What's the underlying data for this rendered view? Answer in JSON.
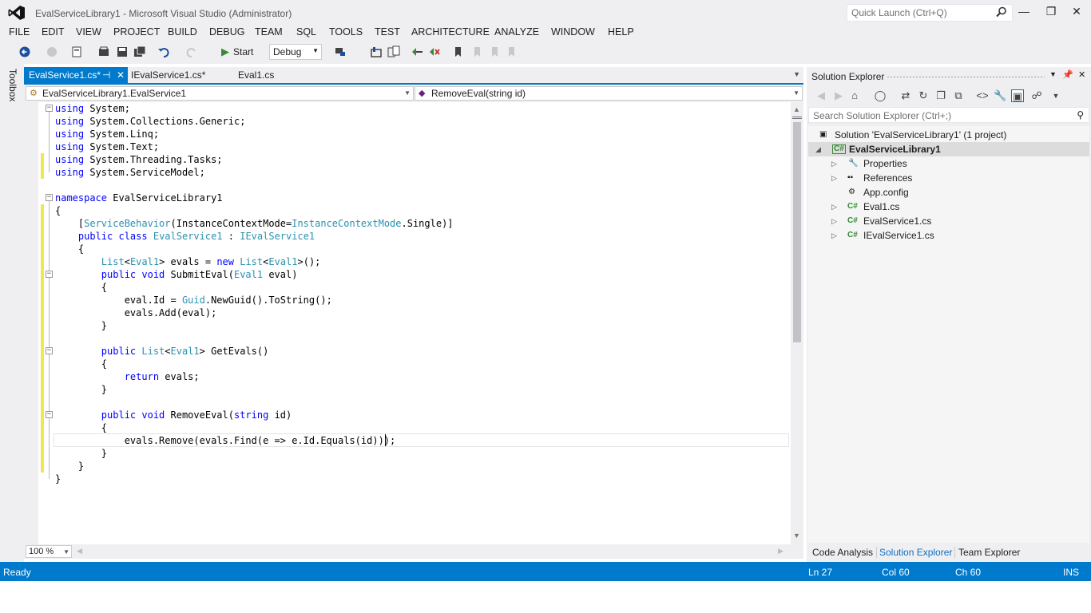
{
  "window": {
    "title": "EvalServiceLibrary1 - Microsoft Visual Studio (Administrator)",
    "quick_launch_placeholder": "Quick Launch (Ctrl+Q)"
  },
  "menu": [
    "FILE",
    "EDIT",
    "VIEW",
    "PROJECT",
    "BUILD",
    "DEBUG",
    "TEAM",
    "SQL",
    "TOOLS",
    "TEST",
    "ARCHITECTURE",
    "ANALYZE",
    "WINDOW",
    "HELP"
  ],
  "toolbar": {
    "start_label": "Start",
    "configuration": "Debug"
  },
  "toolbox_label": "Toolbox",
  "tabs": [
    {
      "label": "EvalService1.cs*",
      "active": true,
      "pin": "⊣",
      "close": "✕"
    },
    {
      "label": "IEvalService1.cs*",
      "active": false
    },
    {
      "label": "Eval1.cs",
      "active": false
    }
  ],
  "navigation": {
    "type_combo": "EvalServiceLibrary1.EvalService1",
    "member_combo": "RemoveEval(string id)"
  },
  "code_lines": [
    [
      {
        "t": "using",
        "c": "kw"
      },
      {
        "t": " System;"
      }
    ],
    [
      {
        "t": "using",
        "c": "kw"
      },
      {
        "t": " System.Collections.Generic;"
      }
    ],
    [
      {
        "t": "using",
        "c": "kw"
      },
      {
        "t": " System.Linq;"
      }
    ],
    [
      {
        "t": "using",
        "c": "kw"
      },
      {
        "t": " System.Text;"
      }
    ],
    [
      {
        "t": "using",
        "c": "kw"
      },
      {
        "t": " System.Threading.Tasks;"
      }
    ],
    [
      {
        "t": "using",
        "c": "kw"
      },
      {
        "t": " System.ServiceModel;"
      }
    ],
    [
      {
        "t": ""
      }
    ],
    [
      {
        "t": "namespace",
        "c": "kw"
      },
      {
        "t": " EvalServiceLibrary1"
      }
    ],
    [
      {
        "t": "{"
      }
    ],
    [
      {
        "t": "    ["
      },
      {
        "t": "ServiceBehavior",
        "c": "ty"
      },
      {
        "t": "(InstanceContextMode="
      },
      {
        "t": "InstanceContextMode",
        "c": "ty"
      },
      {
        "t": ".Single)]"
      }
    ],
    [
      {
        "t": "    "
      },
      {
        "t": "public class",
        "c": "kw"
      },
      {
        "t": " "
      },
      {
        "t": "EvalService1",
        "c": "ty"
      },
      {
        "t": " : "
      },
      {
        "t": "IEvalService1",
        "c": "ty"
      }
    ],
    [
      {
        "t": "    {"
      }
    ],
    [
      {
        "t": "        "
      },
      {
        "t": "List",
        "c": "ty"
      },
      {
        "t": "<"
      },
      {
        "t": "Eval1",
        "c": "ty"
      },
      {
        "t": "> evals = "
      },
      {
        "t": "new",
        "c": "kw"
      },
      {
        "t": " "
      },
      {
        "t": "List",
        "c": "ty"
      },
      {
        "t": "<"
      },
      {
        "t": "Eval1",
        "c": "ty"
      },
      {
        "t": ">();"
      }
    ],
    [
      {
        "t": "        "
      },
      {
        "t": "public void",
        "c": "kw"
      },
      {
        "t": " SubmitEval("
      },
      {
        "t": "Eval1",
        "c": "ty"
      },
      {
        "t": " eval)"
      }
    ],
    [
      {
        "t": "        {"
      }
    ],
    [
      {
        "t": "            eval.Id = "
      },
      {
        "t": "Guid",
        "c": "ty"
      },
      {
        "t": ".NewGuid().ToString();"
      }
    ],
    [
      {
        "t": "            evals.Add(eval);"
      }
    ],
    [
      {
        "t": "        }"
      }
    ],
    [
      {
        "t": ""
      }
    ],
    [
      {
        "t": "        "
      },
      {
        "t": "public",
        "c": "kw"
      },
      {
        "t": " "
      },
      {
        "t": "List",
        "c": "ty"
      },
      {
        "t": "<"
      },
      {
        "t": "Eval1",
        "c": "ty"
      },
      {
        "t": "> GetEvals()"
      }
    ],
    [
      {
        "t": "        {"
      }
    ],
    [
      {
        "t": "            "
      },
      {
        "t": "return",
        "c": "kw"
      },
      {
        "t": " evals;"
      }
    ],
    [
      {
        "t": "        }"
      }
    ],
    [
      {
        "t": ""
      }
    ],
    [
      {
        "t": "        "
      },
      {
        "t": "public void",
        "c": "kw"
      },
      {
        "t": " RemoveEval("
      },
      {
        "t": "string",
        "c": "kw"
      },
      {
        "t": " id)"
      }
    ],
    [
      {
        "t": "        {"
      }
    ],
    [
      {
        "t": "            evals.Remove(evals.Find(e => e.Id.Equals(id)));"
      }
    ],
    [
      {
        "t": "        }"
      }
    ],
    [
      {
        "t": "    }"
      }
    ],
    [
      {
        "t": "}"
      }
    ]
  ],
  "zoom": "100 %",
  "solution_explorer": {
    "title": "Solution Explorer",
    "search_placeholder": "Search Solution Explorer (Ctrl+;)",
    "tree": [
      {
        "label": "Solution 'EvalServiceLibrary1' (1 project)",
        "icon": "solution-icon",
        "level": 0,
        "expander": ""
      },
      {
        "label": "EvalServiceLibrary1",
        "icon": "csharp-project-icon",
        "level": 0,
        "expander": "◢",
        "selected": true
      },
      {
        "label": "Properties",
        "icon": "wrench-icon",
        "level": 1,
        "expander": "▷"
      },
      {
        "label": "References",
        "icon": "references-icon",
        "level": 1,
        "expander": "▷"
      },
      {
        "label": "App.config",
        "icon": "config-file-icon",
        "level": 1,
        "expander": ""
      },
      {
        "label": "Eval1.cs",
        "icon": "csharp-file-icon",
        "level": 1,
        "expander": "▷"
      },
      {
        "label": "EvalService1.cs",
        "icon": "csharp-file-icon",
        "level": 1,
        "expander": "▷"
      },
      {
        "label": "IEvalService1.cs",
        "icon": "csharp-file-icon",
        "level": 1,
        "expander": "▷"
      }
    ],
    "bottom_tabs": [
      "Code Analysis",
      "Solution Explorer",
      "Team Explorer"
    ]
  },
  "status": {
    "state": "Ready",
    "line": "Ln 27",
    "col": "Col 60",
    "ch": "Ch 60",
    "mode": "INS"
  },
  "colors": {
    "accent": "#007acc",
    "keyword": "#0000ff",
    "type": "#2b91af",
    "change_marker": "#f2e64d",
    "chrome": "#efeff2"
  }
}
